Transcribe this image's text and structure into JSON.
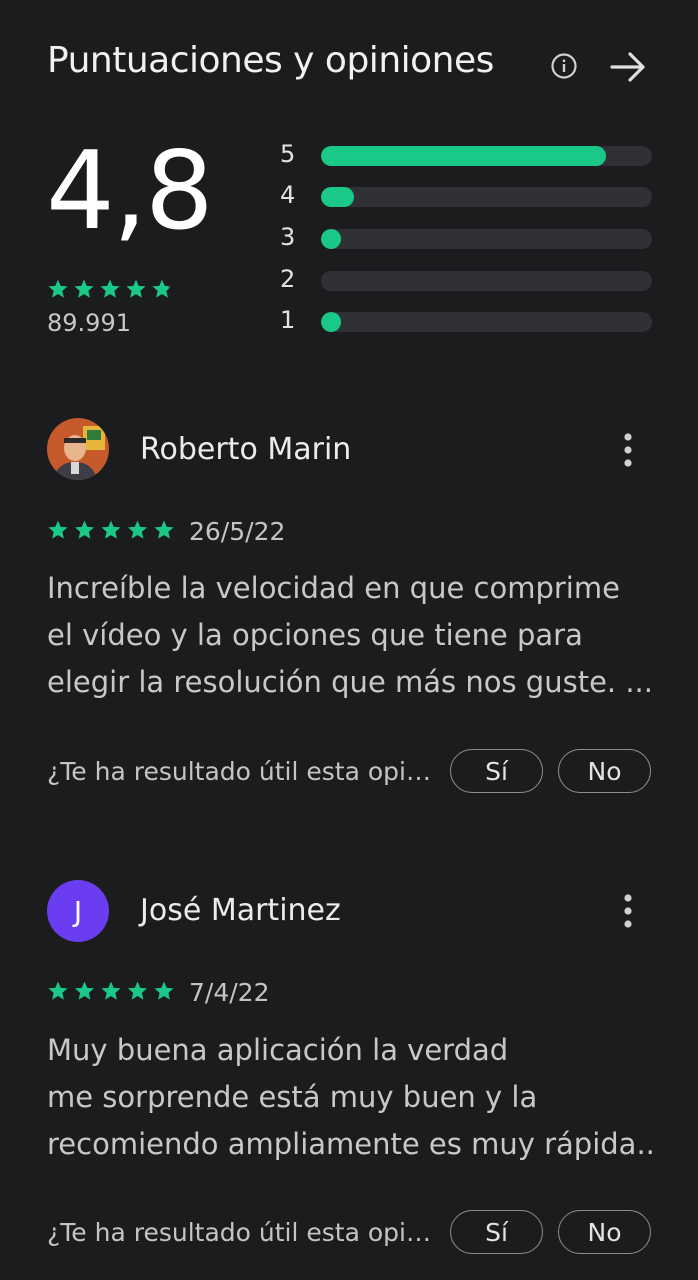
{
  "header": {
    "title": "Puntuaciones y opiniones",
    "info_icon": "info-icon",
    "arrow_icon": "arrow-right-icon"
  },
  "summary": {
    "rating": "4,8",
    "stars_value": 4.8,
    "count": "89.991",
    "bars": [
      {
        "label": "5",
        "fraction": 0.86
      },
      {
        "label": "4",
        "fraction": 0.1
      },
      {
        "label": "3",
        "fraction": 0.03
      },
      {
        "label": "2",
        "fraction": 0.0
      },
      {
        "label": "1",
        "fraction": 0.03
      }
    ],
    "accent_color": "#1ac988"
  },
  "reviews": [
    {
      "name": "Roberto Marin",
      "avatar": "photo",
      "stars": 5,
      "date": "26/5/22",
      "lines": [
        "Increíble la velocidad en que comprime",
        "el vídeo y la opciones que tiene para",
        "elegir la resolución que más nos guste. ..."
      ],
      "helpful_text": "¿Te ha resultado útil esta opinión?",
      "yes_label": "Sí",
      "no_label": "No"
    },
    {
      "name": "José Martinez",
      "avatar": "letter",
      "avatar_letter": "J",
      "avatar_color": "#6b3df0",
      "stars": 5,
      "date": "7/4/22",
      "lines": [
        "Muy buena aplicación la verdad",
        "me sorprende está muy buen y la",
        "recomiendo ampliamente es muy rápida..."
      ],
      "helpful_text": "¿Te ha resultado útil esta opinión?",
      "yes_label": "Sí",
      "no_label": "No"
    }
  ]
}
